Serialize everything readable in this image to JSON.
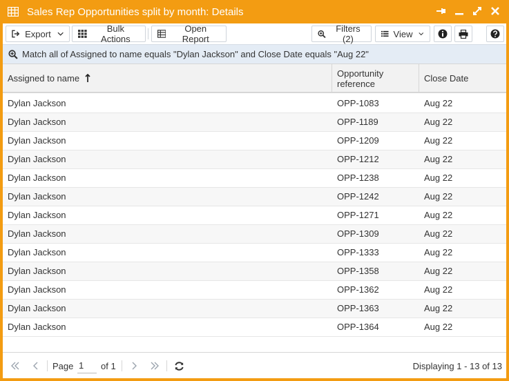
{
  "window": {
    "title": "Sales Rep Opportunities split by month: Details",
    "accent": "#f39c12"
  },
  "toolbar": {
    "export_label": "Export",
    "bulk_actions_label": "Bulk Actions",
    "open_report_label": "Open Report",
    "filters_label": "Filters (2)",
    "view_label": "View"
  },
  "filter": {
    "text": "Match all of Assigned to name equals \"Dylan Jackson\" and Close Date equals \"Aug 22\""
  },
  "table": {
    "columns": [
      {
        "label": "Assigned to name"
      },
      {
        "label": "Opportunity reference"
      },
      {
        "label": "Close Date"
      }
    ],
    "rows": [
      {
        "name": "Dylan Jackson",
        "ref": "OPP-1083",
        "date": "Aug 22"
      },
      {
        "name": "Dylan Jackson",
        "ref": "OPP-1189",
        "date": "Aug 22"
      },
      {
        "name": "Dylan Jackson",
        "ref": "OPP-1209",
        "date": "Aug 22"
      },
      {
        "name": "Dylan Jackson",
        "ref": "OPP-1212",
        "date": "Aug 22"
      },
      {
        "name": "Dylan Jackson",
        "ref": "OPP-1238",
        "date": "Aug 22"
      },
      {
        "name": "Dylan Jackson",
        "ref": "OPP-1242",
        "date": "Aug 22"
      },
      {
        "name": "Dylan Jackson",
        "ref": "OPP-1271",
        "date": "Aug 22"
      },
      {
        "name": "Dylan Jackson",
        "ref": "OPP-1309",
        "date": "Aug 22"
      },
      {
        "name": "Dylan Jackson",
        "ref": "OPP-1333",
        "date": "Aug 22"
      },
      {
        "name": "Dylan Jackson",
        "ref": "OPP-1358",
        "date": "Aug 22"
      },
      {
        "name": "Dylan Jackson",
        "ref": "OPP-1362",
        "date": "Aug 22"
      },
      {
        "name": "Dylan Jackson",
        "ref": "OPP-1363",
        "date": "Aug 22"
      },
      {
        "name": "Dylan Jackson",
        "ref": "OPP-1364",
        "date": "Aug 22"
      }
    ]
  },
  "pager": {
    "page_label": "Page",
    "page_value": "1",
    "of_label": "of 1",
    "display_label": "Displaying 1 - 13 of 13"
  }
}
